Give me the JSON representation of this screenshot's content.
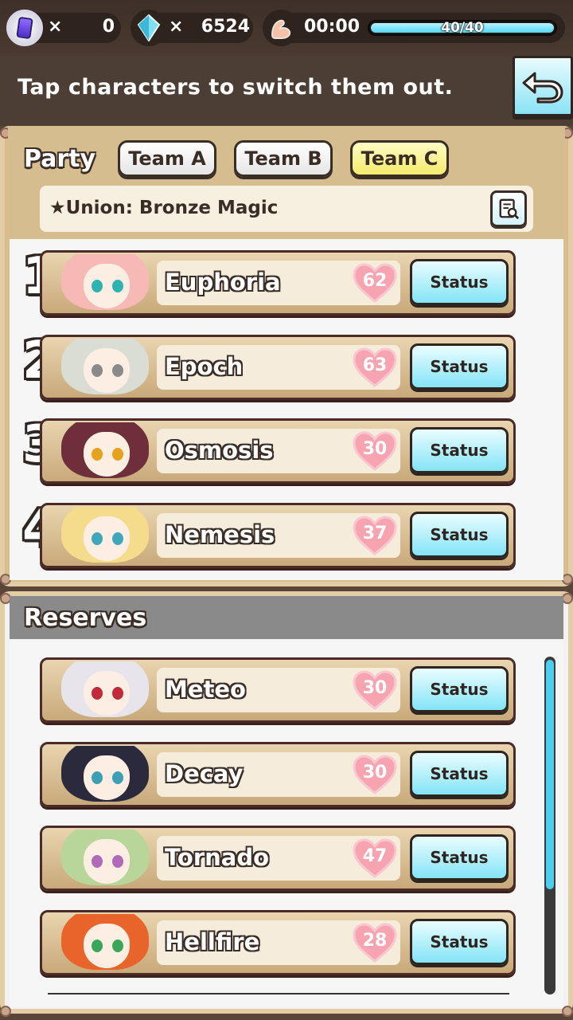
{
  "topbar": {
    "ticket_times": "×",
    "ticket_count": "0",
    "gem_times": "×",
    "gem_count": "6524",
    "stamina_timer": "00:00",
    "stamina_text": "40/40",
    "stamina_fraction": 1.0
  },
  "banner": {
    "text": "Tap characters to switch them out."
  },
  "party": {
    "title": "Party",
    "tabs": [
      {
        "label": "Team A",
        "active": false
      },
      {
        "label": "Team B",
        "active": false
      },
      {
        "label": "Team C",
        "active": true
      }
    ],
    "union": "★Union: Bronze Magic",
    "members": [
      {
        "slot": "1",
        "name": "Euphoria",
        "affection": "62",
        "status_label": "Status",
        "hair": "#f6b9b5",
        "eye": "#2fb3b0"
      },
      {
        "slot": "2",
        "name": "Epoch",
        "affection": "63",
        "status_label": "Status",
        "hair": "#d9ddd3",
        "eye": "#8a8a8a"
      },
      {
        "slot": "3",
        "name": "Osmosis",
        "affection": "30",
        "status_label": "Status",
        "hair": "#6e2f3a",
        "eye": "#e6a21c"
      },
      {
        "slot": "4",
        "name": "Nemesis",
        "affection": "37",
        "status_label": "Status",
        "hair": "#f4dc8c",
        "eye": "#3fa7b9"
      }
    ]
  },
  "reserves": {
    "title": "Reserves",
    "members": [
      {
        "name": "Meteo",
        "affection": "30",
        "status_label": "Status",
        "hair": "#e8e4ec",
        "eye": "#c22a3a"
      },
      {
        "name": "Decay",
        "affection": "30",
        "status_label": "Status",
        "hair": "#2b2a3d",
        "eye": "#3b9fb6"
      },
      {
        "name": "Tornado",
        "affection": "47",
        "status_label": "Status",
        "hair": "#b8d69a",
        "eye": "#b06ab8"
      },
      {
        "name": "Hellfire",
        "affection": "28",
        "status_label": "Status",
        "hair": "#e8642a",
        "eye": "#3aa65a"
      }
    ]
  },
  "colors": {
    "accent_cyan": "#84e4f7",
    "heart_pink": "#f59aa8",
    "active_tab": "#f6ea6e"
  }
}
